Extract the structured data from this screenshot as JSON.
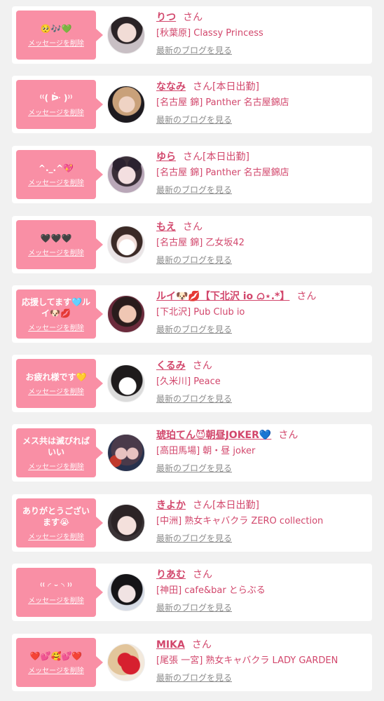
{
  "colors": {
    "background": "#f1f1f1",
    "card": "#ffffff",
    "bubble": "#f98fa5",
    "name_text": "#d2476c",
    "blog_link": "#8c8c8c"
  },
  "delete_label": "メッセージを削除",
  "blog_label": "最新のブログを見る",
  "san_label": "さん",
  "items": [
    {
      "message": "🥺🎶💚",
      "name": "りつ",
      "working": "",
      "shop": "[秋葉原] Classy Princess"
    },
    {
      "message": "⁽⁽(  ᐕ )⁾⁾",
      "name": "ななみ",
      "working": "[本日出勤]",
      "shop": "[名古屋 錦] Panther 名古屋錦店"
    },
    {
      "message": "^._.^💖",
      "name": "ゆら",
      "working": "[本日出勤]",
      "shop": "[名古屋 錦] Panther 名古屋錦店"
    },
    {
      "message": "🖤🖤🖤",
      "name": "もえ",
      "working": "",
      "shop": "[名古屋 錦] 乙女坂42"
    },
    {
      "message": "応援してます🩵ルイ🐶💋",
      "name": "ルイ🐶💋【下北沢 io ᜊ⋆.*】",
      "working": "",
      "shop": "[下北沢] Pub Club io"
    },
    {
      "message": "お疲れ様です💛",
      "name": "くるみ",
      "working": "",
      "shop": "[久米川] Peace"
    },
    {
      "message": "メス共は滅びればいい",
      "name": "琥珀てん😈朝昼JOKER💙",
      "working": "",
      "shop": "[高田馬場] 朝・昼 joker"
    },
    {
      "message": "ありがとうございます😭",
      "name": "きよか",
      "working": "[本日出勤]",
      "shop": "[中洲] 熟女キャバクラ ZERO collection"
    },
    {
      "message": "⁽⁽ ◜ ᵕ ◝ ⁾⁾",
      "name": "りあむ",
      "working": "",
      "shop": "[神田] cafe&bar とらぶる"
    },
    {
      "message": "❤️💕🥰💕❤️",
      "name": "MIKA",
      "working": "",
      "shop": "[尾張 一宮] 熟女キャバクラ LADY GARDEN"
    }
  ]
}
